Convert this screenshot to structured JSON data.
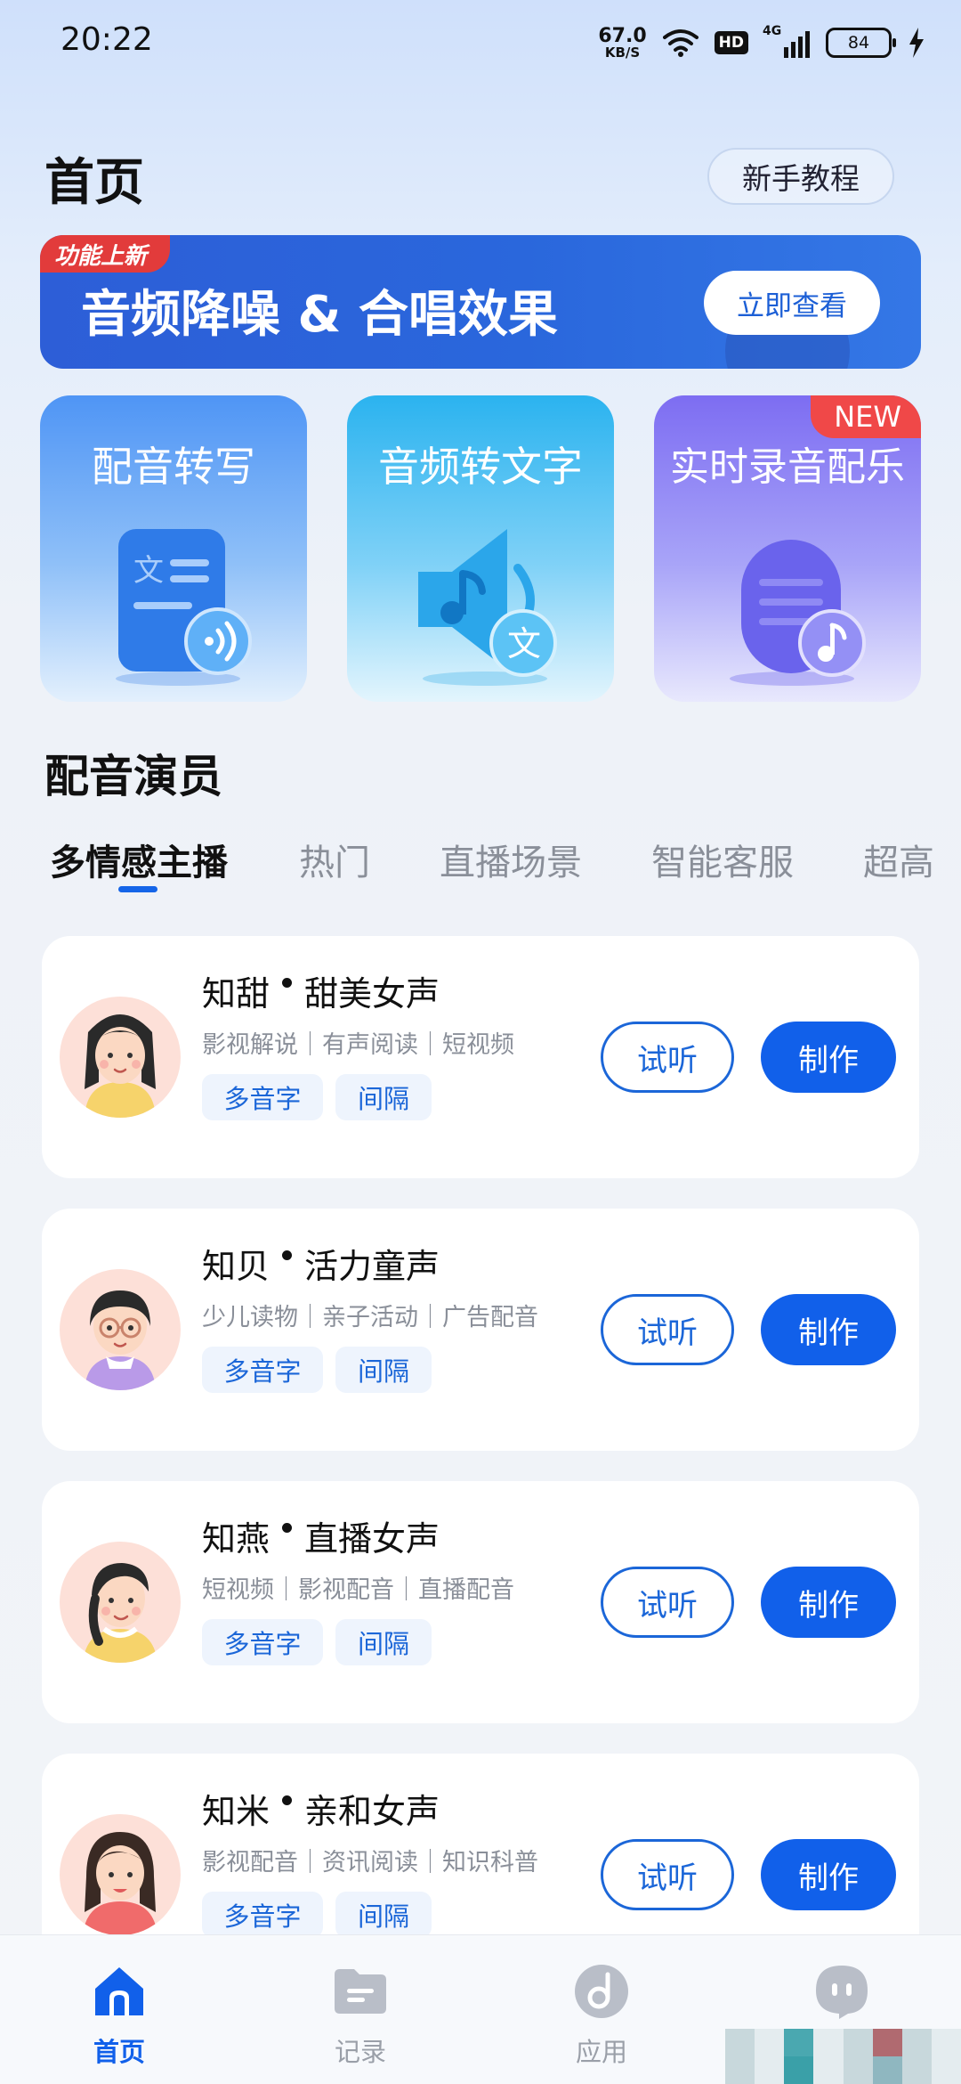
{
  "status_bar": {
    "time": "20:22",
    "net_speed_value": "67.0",
    "net_speed_unit": "KB/S",
    "hd_label": "HD",
    "network_label": "4G",
    "battery_level": "84"
  },
  "header": {
    "title": "首页",
    "tutorial_button": "新手教程"
  },
  "banner": {
    "tag": "功能上新",
    "title": "音频降噪 & 合唱效果",
    "button": "立即查看"
  },
  "features": [
    {
      "label": "配音转写",
      "icon": "document-audio-icon"
    },
    {
      "label": "音频转文字",
      "icon": "speaker-text-icon"
    },
    {
      "label": "实时录音配乐",
      "icon": "microphone-music-icon",
      "badge": "NEW"
    }
  ],
  "section": {
    "title": "配音演员",
    "tabs": [
      "多情感主播",
      "热门",
      "直播场景",
      "智能客服",
      "超高"
    ]
  },
  "voices": [
    {
      "first": "知甜",
      "second": "甜美女声",
      "tags": "影视解说｜有声阅读｜短视频",
      "chip1": "多音字",
      "chip2": "间隔",
      "listen": "试听",
      "make": "制作"
    },
    {
      "first": "知贝",
      "second": "活力童声",
      "tags": "少儿读物｜亲子活动｜广告配音",
      "chip1": "多音字",
      "chip2": "间隔",
      "listen": "试听",
      "make": "制作"
    },
    {
      "first": "知燕",
      "second": "直播女声",
      "tags": "短视频｜影视配音｜直播配音",
      "chip1": "多音字",
      "chip2": "间隔",
      "listen": "试听",
      "make": "制作"
    },
    {
      "first": "知米",
      "second": "亲和女声",
      "tags": "影视配音｜资讯阅读｜知识科普",
      "chip1": "多音字",
      "chip2": "间隔",
      "listen": "试听",
      "make": "制作"
    }
  ],
  "bottom_nav": {
    "items": [
      {
        "label": "首页",
        "icon": "home-icon",
        "active": true
      },
      {
        "label": "记录",
        "icon": "folder-icon",
        "active": false
      },
      {
        "label": "应用",
        "icon": "music-disc-icon",
        "active": false
      },
      {
        "label": "",
        "icon": "chat-bot-icon",
        "active": false
      }
    ]
  },
  "colors": {
    "primary": "#1160ea",
    "banner": "#2d5ed7",
    "new_badge": "#f04848",
    "tag_red": "#e23b3b"
  }
}
